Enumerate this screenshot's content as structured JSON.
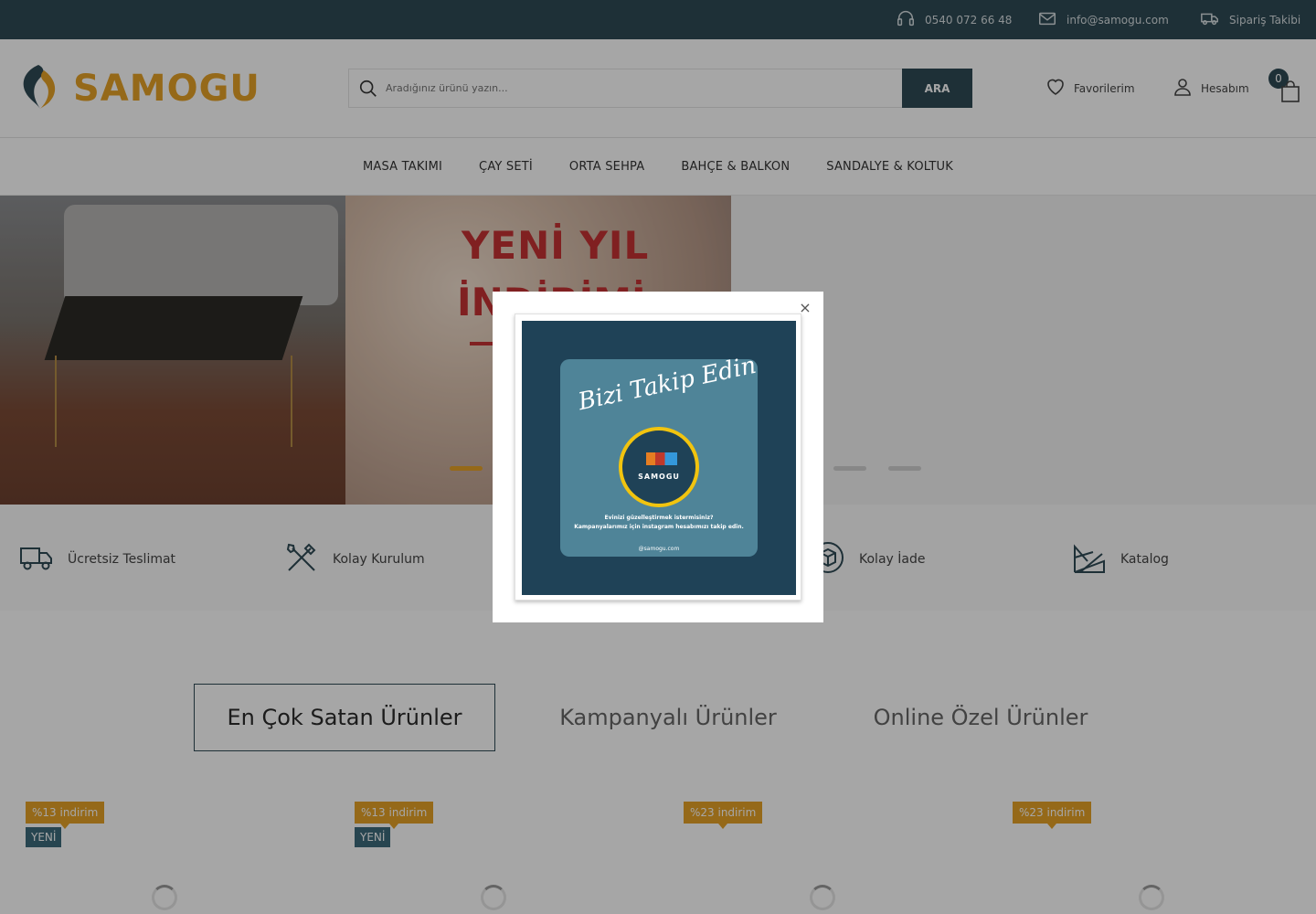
{
  "topbar": {
    "phone": "0540 072 66 48",
    "email": "info@samogu.com",
    "tracking": "Sipariş Takibi"
  },
  "header": {
    "logo_text": "SAMOGU",
    "search_placeholder": "Aradığınız ürünü yazın...",
    "search_button": "ARA",
    "favorites": "Favorilerim",
    "account": "Hesabım",
    "cart_count": "0"
  },
  "nav": {
    "items": [
      "MASA TAKIMI",
      "ÇAY SETİ",
      "ORTA SEHPA",
      "BAHÇE & BALKON",
      "SANDALYE & KOLTUK"
    ]
  },
  "hero": {
    "title_line1": "YENİ YIL",
    "title_line2": "İNDİRİMİ"
  },
  "features": {
    "items": [
      "Ücretsiz Teslimat",
      "Kolay Kurulum",
      "Kolay İade",
      "Katalog"
    ]
  },
  "tabs": {
    "items": [
      "En Çok Satan Ürünler",
      "Kampanyalı Ürünler",
      "Online Özel Ürünler"
    ]
  },
  "products": {
    "discounts": [
      "%13 indirim",
      "%13 indirim",
      "%23 indirim",
      "%23 indirim"
    ],
    "new_label": "YENİ"
  },
  "modal": {
    "close": "×",
    "promo_script": "Bizi Takip Edin",
    "promo_brand": "SAMOGU",
    "promo_line1": "Evinizi güzelleştirmek istermisiniz?",
    "promo_line2": "Kampanyalarımız için instagram hesabımızı takip edin.",
    "promo_handle": "@samogu.com"
  },
  "colors": {
    "primary": "#2f4a55",
    "accent": "#e5a127",
    "hero_red": "#c53234"
  }
}
